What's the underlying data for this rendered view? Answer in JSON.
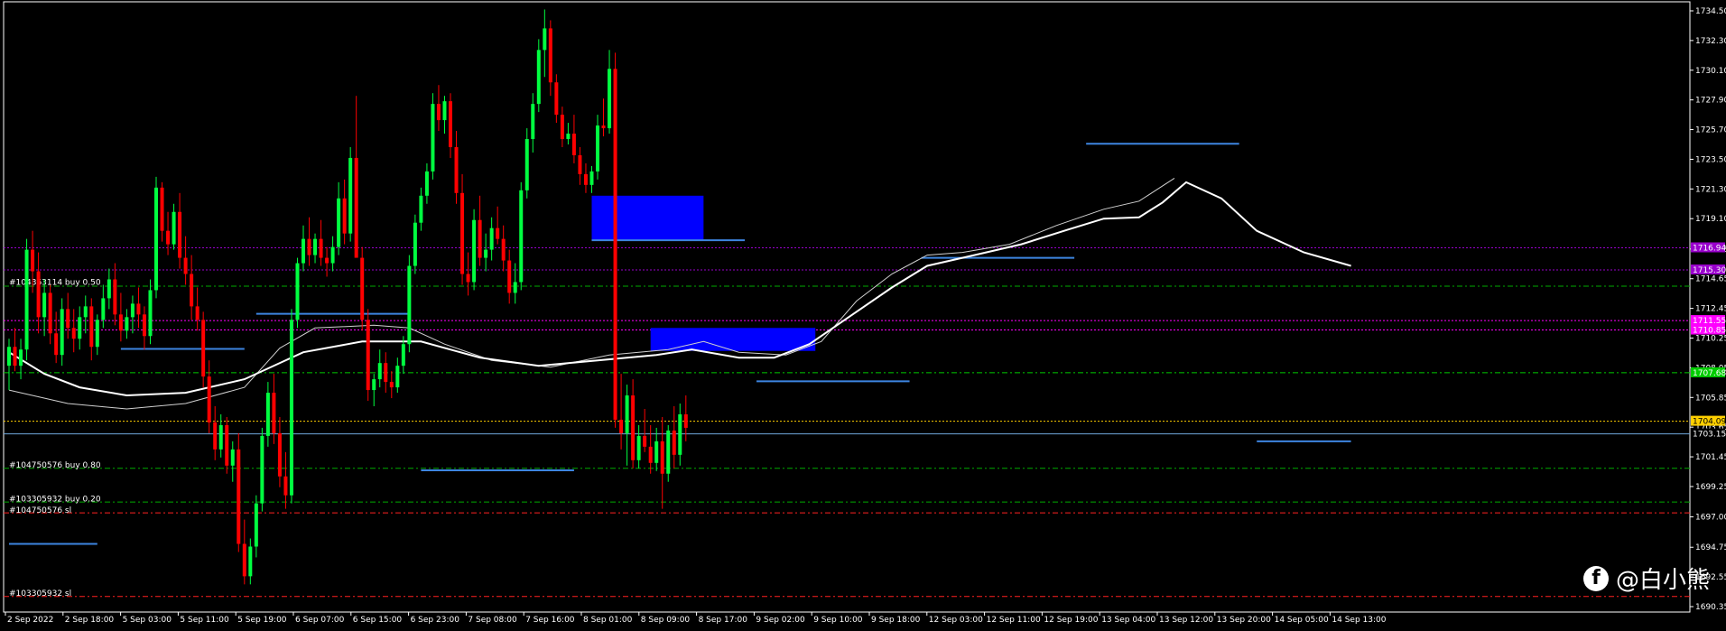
{
  "chart_data": {
    "type": "candlestick",
    "symbol_hint": "",
    "ylim": [
      1690.35,
      1734.5
    ],
    "price_ticks": [
      "1734.50",
      "1732.30",
      "1730.10",
      "1727.90",
      "1725.70",
      "1723.50",
      "1721.30",
      "1719.10",
      "1716.85",
      "1714.65",
      "1712.45",
      "1710.25",
      "1708.05",
      "1705.85",
      "1703.65",
      "1701.45",
      "1699.25",
      "1697.00",
      "1694.75",
      "1692.55",
      "1690.35"
    ],
    "time_labels": [
      "2 Sep 2022",
      "2 Sep 18:00",
      "5 Sep 03:00",
      "5 Sep 11:00",
      "5 Sep 19:00",
      "6 Sep 07:00",
      "6 Sep 15:00",
      "6 Sep 23:00",
      "7 Sep 08:00",
      "7 Sep 16:00",
      "8 Sep 01:00",
      "8 Sep 09:00",
      "8 Sep 17:00",
      "9 Sep 02:00",
      "9 Sep 10:00",
      "9 Sep 18:00",
      "12 Sep 03:00",
      "12 Sep 11:00",
      "12 Sep 19:00",
      "13 Sep 04:00",
      "13 Sep 12:00",
      "13 Sep 20:00",
      "14 Sep 05:00",
      "14 Sep 13:00"
    ],
    "current_price": "1704.09",
    "current_price2": "1703.15",
    "price_levels": [
      {
        "price": 1716.94,
        "label": "1716.94",
        "color": "#9900cc",
        "style": "dotted"
      },
      {
        "price": 1715.3,
        "label": "1715.30",
        "color": "#9900cc",
        "style": "dotted"
      },
      {
        "price": 1714.1,
        "label": "",
        "color": "#00aa00",
        "style": "dashdot"
      },
      {
        "price": 1711.55,
        "label": "1711.55",
        "color": "#ff00ff",
        "style": "dotted"
      },
      {
        "price": 1710.85,
        "label": "1710.85",
        "color": "#ff00ff",
        "style": "dotted"
      },
      {
        "price": 1707.68,
        "label": "1707.68",
        "color": "#00cc00",
        "style": "dashdot"
      },
      {
        "price": 1704.09,
        "label": "1704.09",
        "color": "#ffd000",
        "style": "dotted"
      },
      {
        "price": 1703.15,
        "label": "1703.15",
        "color": "#6fa8dc",
        "style": "solid"
      },
      {
        "price": 1700.6,
        "label": "",
        "color": "#00aa00",
        "style": "dashdot"
      },
      {
        "price": 1698.1,
        "label": "",
        "color": "#00aa00",
        "style": "dashdot"
      },
      {
        "price": 1697.3,
        "label": "",
        "color": "#ff2020",
        "style": "dashdot"
      },
      {
        "price": 1691.1,
        "label": "",
        "color": "#ff2020",
        "style": "dashdot"
      }
    ],
    "order_labels": [
      {
        "text": "#104363114 buy 0.50",
        "price": 1714.4
      },
      {
        "text": "#104750576 buy 0.80",
        "price": 1700.85
      },
      {
        "text": "#103305932 buy 0.20",
        "price": 1698.35
      },
      {
        "text": "#104750576 sl",
        "price": 1697.5
      },
      {
        "text": "#103305932 sl",
        "price": 1691.35
      }
    ],
    "blue_zones": [
      {
        "i0": 99,
        "i1": 118,
        "top": 1720.8,
        "bottom": 1717.5
      },
      {
        "i0": 109,
        "i1": 137,
        "top": 1711.0,
        "bottom": 1709.3
      }
    ],
    "segments": [
      {
        "i0": 0,
        "i1": 15,
        "price": 1695.0
      },
      {
        "i0": 19,
        "i1": 40,
        "price": 1709.45
      },
      {
        "i0": 42,
        "i1": 68,
        "price": 1712.05
      },
      {
        "i0": 70,
        "i1": 96,
        "price": 1700.45
      },
      {
        "i0": 99,
        "i1": 125,
        "price": 1717.5
      },
      {
        "i0": 127,
        "i1": 153,
        "price": 1707.05
      },
      {
        "i0": 155,
        "i1": 181,
        "price": 1716.2
      },
      {
        "i0": 183,
        "i1": 209,
        "price": 1724.65
      },
      {
        "i0": 212,
        "i1": 228,
        "price": 1702.6
      }
    ],
    "ma_fast": [
      [
        0,
        1706.4
      ],
      [
        10,
        1705.4
      ],
      [
        20,
        1705.0
      ],
      [
        30,
        1705.4
      ],
      [
        40,
        1706.6
      ],
      [
        46,
        1709.5
      ],
      [
        52,
        1711.0
      ],
      [
        62,
        1711.2
      ],
      [
        68,
        1711.0
      ],
      [
        74,
        1709.8
      ],
      [
        82,
        1708.6
      ],
      [
        92,
        1708.1
      ],
      [
        102,
        1709.0
      ],
      [
        112,
        1709.4
      ],
      [
        118,
        1710.0
      ],
      [
        124,
        1709.2
      ],
      [
        132,
        1709.0
      ],
      [
        138,
        1710.0
      ],
      [
        144,
        1713.0
      ],
      [
        150,
        1715.0
      ],
      [
        156,
        1716.4
      ],
      [
        162,
        1716.6
      ],
      [
        170,
        1717.2
      ],
      [
        178,
        1718.6
      ],
      [
        186,
        1719.8
      ],
      [
        192,
        1720.4
      ],
      [
        198,
        1722.1
      ]
    ],
    "ma_slow": [
      [
        0,
        1709.2
      ],
      [
        6,
        1707.6
      ],
      [
        12,
        1706.6
      ],
      [
        20,
        1706.0
      ],
      [
        30,
        1706.2
      ],
      [
        40,
        1707.2
      ],
      [
        50,
        1709.2
      ],
      [
        60,
        1710.0
      ],
      [
        70,
        1710.0
      ],
      [
        80,
        1708.8
      ],
      [
        90,
        1708.2
      ],
      [
        100,
        1708.6
      ],
      [
        110,
        1709.0
      ],
      [
        116,
        1709.4
      ],
      [
        124,
        1708.8
      ],
      [
        130,
        1708.8
      ],
      [
        136,
        1709.8
      ],
      [
        142,
        1711.6
      ],
      [
        150,
        1714.0
      ],
      [
        156,
        1715.6
      ],
      [
        164,
        1716.4
      ],
      [
        172,
        1717.2
      ],
      [
        180,
        1718.3
      ],
      [
        186,
        1719.1
      ],
      [
        192,
        1719.2
      ],
      [
        196,
        1720.3
      ],
      [
        200,
        1721.8
      ],
      [
        206,
        1720.6
      ],
      [
        212,
        1718.2
      ],
      [
        220,
        1716.6
      ],
      [
        228,
        1715.6
      ]
    ],
    "candles": [
      [
        1708.2,
        1710.2,
        1706.4,
        1709.6
      ],
      [
        1709.6,
        1711.0,
        1707.8,
        1708.2
      ],
      [
        1708.2,
        1710.2,
        1707.2,
        1709.4
      ],
      [
        1709.4,
        1717.6,
        1708.6,
        1716.8
      ],
      [
        1716.8,
        1718.2,
        1713.6,
        1715.2
      ],
      [
        1715.2,
        1716.6,
        1710.6,
        1711.8
      ],
      [
        1711.8,
        1714.6,
        1710.4,
        1713.6
      ],
      [
        1713.6,
        1714.2,
        1709.8,
        1710.6
      ],
      [
        1710.6,
        1712.2,
        1708.4,
        1709.0
      ],
      [
        1709.0,
        1713.2,
        1708.2,
        1712.4
      ],
      [
        1712.4,
        1713.6,
        1710.2,
        1711.0
      ],
      [
        1711.0,
        1712.4,
        1709.2,
        1710.2
      ],
      [
        1710.2,
        1712.6,
        1709.4,
        1711.8
      ],
      [
        1711.8,
        1713.4,
        1710.6,
        1712.6
      ],
      [
        1712.6,
        1713.2,
        1708.6,
        1709.6
      ],
      [
        1709.6,
        1712.0,
        1709.0,
        1711.6
      ],
      [
        1711.6,
        1714.2,
        1711.0,
        1713.2
      ],
      [
        1713.2,
        1715.4,
        1712.4,
        1714.6
      ],
      [
        1714.6,
        1715.8,
        1711.2,
        1712.0
      ],
      [
        1712.0,
        1713.6,
        1710.0,
        1710.8
      ],
      [
        1710.8,
        1712.4,
        1710.2,
        1711.8
      ],
      [
        1711.8,
        1713.4,
        1710.6,
        1712.8
      ],
      [
        1712.8,
        1714.0,
        1711.0,
        1712.0
      ],
      [
        1712.0,
        1712.6,
        1709.4,
        1710.4
      ],
      [
        1710.4,
        1714.6,
        1709.8,
        1713.8
      ],
      [
        1713.8,
        1722.2,
        1713.2,
        1721.4
      ],
      [
        1721.4,
        1721.8,
        1717.4,
        1718.2
      ],
      [
        1718.2,
        1719.6,
        1716.4,
        1717.2
      ],
      [
        1717.2,
        1720.2,
        1716.8,
        1719.6
      ],
      [
        1719.6,
        1721.0,
        1715.4,
        1716.2
      ],
      [
        1716.2,
        1717.8,
        1714.2,
        1715.0
      ],
      [
        1715.0,
        1716.4,
        1711.6,
        1712.6
      ],
      [
        1712.6,
        1714.0,
        1710.8,
        1711.6
      ],
      [
        1711.6,
        1712.2,
        1706.6,
        1707.4
      ],
      [
        1707.4,
        1708.6,
        1703.2,
        1704.0
      ],
      [
        1704.0,
        1705.2,
        1701.2,
        1702.0
      ],
      [
        1702.0,
        1704.6,
        1701.4,
        1703.8
      ],
      [
        1703.8,
        1704.4,
        1700.2,
        1700.8
      ],
      [
        1700.8,
        1702.6,
        1699.6,
        1702.0
      ],
      [
        1702.0,
        1703.2,
        1694.4,
        1695.0
      ],
      [
        1695.0,
        1696.8,
        1692.0,
        1692.6
      ],
      [
        1692.6,
        1695.4,
        1692.0,
        1694.8
      ],
      [
        1694.8,
        1698.6,
        1694.0,
        1698.0
      ],
      [
        1698.0,
        1703.6,
        1697.4,
        1703.0
      ],
      [
        1703.0,
        1707.0,
        1702.2,
        1706.2
      ],
      [
        1706.2,
        1707.6,
        1702.4,
        1703.2
      ],
      [
        1703.2,
        1704.4,
        1699.2,
        1700.0
      ],
      [
        1700.0,
        1701.8,
        1697.6,
        1698.6
      ],
      [
        1698.6,
        1712.4,
        1698.0,
        1711.6
      ],
      [
        1711.6,
        1716.2,
        1711.0,
        1715.8
      ],
      [
        1715.8,
        1718.6,
        1715.2,
        1717.6
      ],
      [
        1717.6,
        1719.2,
        1715.6,
        1716.4
      ],
      [
        1716.4,
        1718.0,
        1715.8,
        1717.6
      ],
      [
        1717.6,
        1719.0,
        1715.6,
        1716.2
      ],
      [
        1716.2,
        1717.0,
        1714.8,
        1715.8
      ],
      [
        1715.8,
        1717.8,
        1715.2,
        1717.0
      ],
      [
        1717.0,
        1721.8,
        1716.4,
        1720.6
      ],
      [
        1720.6,
        1722.0,
        1717.2,
        1718.0
      ],
      [
        1718.0,
        1724.4,
        1717.4,
        1723.6
      ],
      [
        1723.6,
        1728.2,
        1720.0,
        1716.2
      ],
      [
        1716.2,
        1717.0,
        1710.8,
        1711.6
      ],
      [
        1711.6,
        1712.4,
        1705.6,
        1706.4
      ],
      [
        1706.4,
        1707.6,
        1705.2,
        1707.2
      ],
      [
        1707.2,
        1709.4,
        1706.6,
        1708.4
      ],
      [
        1708.4,
        1709.2,
        1706.2,
        1707.0
      ],
      [
        1707.0,
        1707.8,
        1705.8,
        1706.6
      ],
      [
        1706.6,
        1708.8,
        1706.2,
        1708.2
      ],
      [
        1708.2,
        1710.4,
        1707.6,
        1709.8
      ],
      [
        1709.8,
        1716.4,
        1709.2,
        1715.6
      ],
      [
        1715.6,
        1719.4,
        1715.0,
        1718.8
      ],
      [
        1718.8,
        1721.4,
        1718.2,
        1720.8
      ],
      [
        1720.8,
        1723.2,
        1720.2,
        1722.6
      ],
      [
        1722.6,
        1728.4,
        1722.0,
        1727.6
      ],
      [
        1727.6,
        1729.0,
        1725.6,
        1726.4
      ],
      [
        1726.4,
        1728.2,
        1725.4,
        1727.8
      ],
      [
        1727.8,
        1728.4,
        1723.6,
        1724.4
      ],
      [
        1724.4,
        1725.6,
        1720.2,
        1721.0
      ],
      [
        1721.0,
        1722.4,
        1714.2,
        1715.0
      ],
      [
        1715.0,
        1716.6,
        1713.4,
        1714.4
      ],
      [
        1714.4,
        1719.8,
        1713.8,
        1719.0
      ],
      [
        1719.0,
        1720.8,
        1715.6,
        1716.2
      ],
      [
        1716.2,
        1718.0,
        1715.2,
        1716.8
      ],
      [
        1716.8,
        1719.2,
        1716.0,
        1718.4
      ],
      [
        1718.4,
        1720.0,
        1717.2,
        1717.6
      ],
      [
        1717.6,
        1718.6,
        1715.2,
        1716.0
      ],
      [
        1716.0,
        1716.8,
        1712.8,
        1713.6
      ],
      [
        1713.6,
        1715.8,
        1712.8,
        1714.4
      ],
      [
        1714.4,
        1721.8,
        1713.8,
        1721.2
      ],
      [
        1721.2,
        1725.8,
        1720.6,
        1725.0
      ],
      [
        1725.0,
        1728.4,
        1724.0,
        1727.6
      ],
      [
        1727.6,
        1732.4,
        1727.0,
        1731.6
      ],
      [
        1731.6,
        1734.6,
        1729.6,
        1733.2
      ],
      [
        1733.2,
        1733.8,
        1728.2,
        1729.2
      ],
      [
        1729.2,
        1729.8,
        1726.2,
        1726.8
      ],
      [
        1726.8,
        1727.4,
        1724.4,
        1725.0
      ],
      [
        1725.0,
        1726.2,
        1724.6,
        1725.4
      ],
      [
        1725.4,
        1726.8,
        1723.2,
        1723.8
      ],
      [
        1723.8,
        1724.4,
        1721.6,
        1722.4
      ],
      [
        1722.4,
        1723.2,
        1721.0,
        1721.6
      ],
      [
        1721.6,
        1723.0,
        1721.0,
        1722.6
      ],
      [
        1722.6,
        1726.8,
        1722.0,
        1726.0
      ],
      [
        1726.0,
        1728.0,
        1725.2,
        1725.8
      ],
      [
        1725.8,
        1731.6,
        1725.4,
        1730.2
      ],
      [
        1730.2,
        1731.4,
        1703.6,
        1704.2
      ],
      [
        1704.2,
        1707.6,
        1702.0,
        1703.2
      ],
      [
        1703.2,
        1706.8,
        1700.8,
        1706.0
      ],
      [
        1706.0,
        1707.2,
        1700.6,
        1701.2
      ],
      [
        1701.2,
        1703.8,
        1700.6,
        1703.0
      ],
      [
        1703.0,
        1705.0,
        1701.8,
        1702.2
      ],
      [
        1702.2,
        1703.8,
        1700.2,
        1701.0
      ],
      [
        1701.0,
        1703.6,
        1700.4,
        1702.6
      ],
      [
        1702.6,
        1704.4,
        1697.6,
        1700.2
      ],
      [
        1700.2,
        1703.8,
        1699.6,
        1703.4
      ],
      [
        1703.4,
        1705.2,
        1700.6,
        1701.6
      ],
      [
        1701.6,
        1705.4,
        1700.8,
        1704.6
      ],
      [
        1704.6,
        1706.0,
        1702.6,
        1703.6
      ]
    ]
  }
}
